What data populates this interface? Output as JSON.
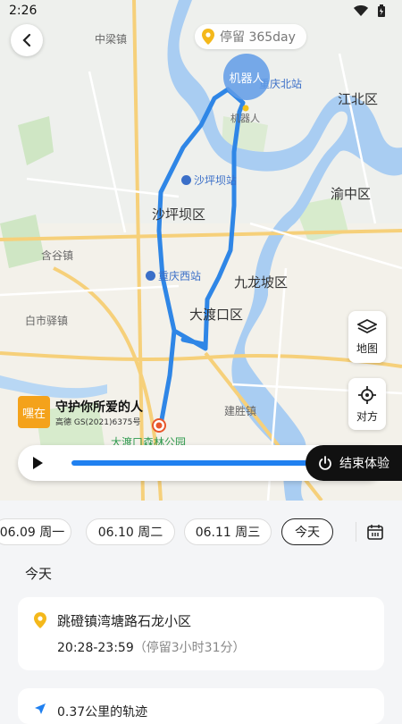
{
  "status_bar": {
    "time": "2:26"
  },
  "header": {
    "stay_label": "停留 365day"
  },
  "map": {
    "robot_marker": "机器人",
    "labels": [
      {
        "id": "zhongliang",
        "text": "中梁镇",
        "kind": "gray"
      },
      {
        "id": "robot-sub",
        "text": "机器人",
        "kind": "gray"
      },
      {
        "id": "chongqing-north",
        "text": "重庆北站",
        "kind": "blue"
      },
      {
        "id": "jiangbei",
        "text": "江北区",
        "kind": "big"
      },
      {
        "id": "shapingba-station",
        "text": "沙坪坝站",
        "kind": "blue"
      },
      {
        "id": "yuzhong",
        "text": "渝中区",
        "kind": "big"
      },
      {
        "id": "shapingba",
        "text": "沙坪坝区",
        "kind": "big"
      },
      {
        "id": "hanggu",
        "text": "含谷镇",
        "kind": "gray"
      },
      {
        "id": "chongqing-west",
        "text": "重庆西站",
        "kind": "blue"
      },
      {
        "id": "jiulongpo",
        "text": "九龙坡区",
        "kind": "big"
      },
      {
        "id": "baishiyi",
        "text": "白市驿镇",
        "kind": "gray"
      },
      {
        "id": "dadukou",
        "text": "大渡口区",
        "kind": "big"
      },
      {
        "id": "jiansheng",
        "text": "建胜镇",
        "kind": "gray"
      },
      {
        "id": "park",
        "text": "大渡口森林公园",
        "kind": "park"
      }
    ],
    "layer_button_label": "地图",
    "partner_button_label": "对方",
    "logo_text": "嘿在",
    "slogan": "守护你所爱的人",
    "license": "高德 GS(2021)6375号"
  },
  "player": {
    "end_label": "结束体验"
  },
  "days": [
    {
      "label": "06.09 周一",
      "active": false
    },
    {
      "label": "06.10 周二",
      "active": false
    },
    {
      "label": "06.11 周三",
      "active": false
    },
    {
      "label": "今天",
      "active": true
    }
  ],
  "section_title": "今天",
  "stay_card": {
    "address": "跳磴镇湾塘路石龙小区",
    "time_range": "20:28-23:59",
    "duration": "（停留3小时31分）"
  },
  "track_card": {
    "distance": "0.37公里的轨迹"
  },
  "colors": {
    "route": "#2f86e6",
    "accent": "#f4a21b",
    "end_button": "#111111",
    "progress": "#2080f0"
  }
}
